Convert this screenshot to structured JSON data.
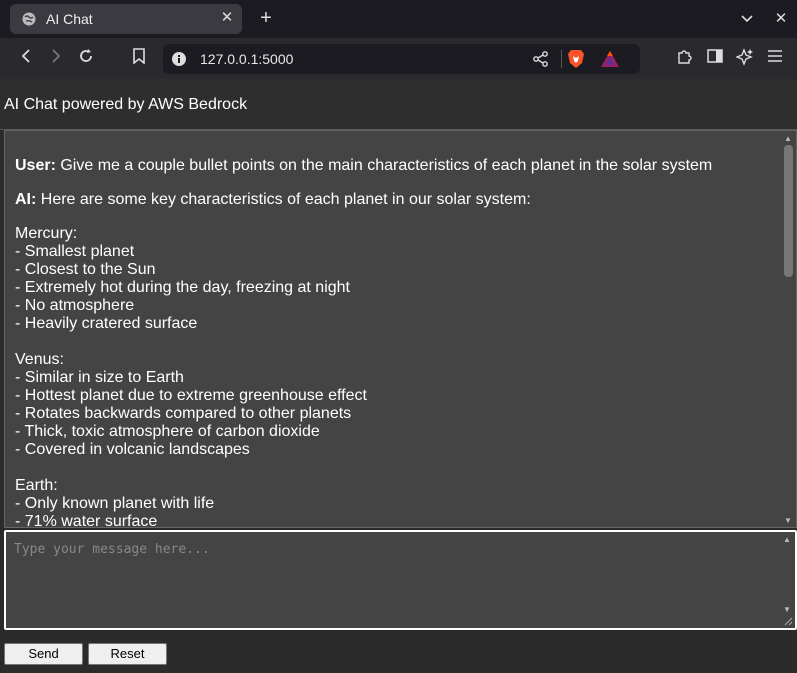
{
  "browser": {
    "tab_title": "AI Chat",
    "url": "127.0.0.1:5000"
  },
  "app": {
    "header_title": "AI Chat powered by AWS Bedrock"
  },
  "chat": {
    "messages": [
      {
        "speaker": "User:",
        "text": " Give me a couple bullet points on the main characteristics of each planet in the solar system"
      },
      {
        "speaker": "AI:",
        "text": " Here are some key characteristics of each planet in our solar system:"
      }
    ],
    "ai_body": "Mercury:\n- Smallest planet\n- Closest to the Sun\n- Extremely hot during the day, freezing at night\n- No atmosphere\n- Heavily cratered surface\n\nVenus:\n- Similar in size to Earth\n- Hottest planet due to extreme greenhouse effect\n- Rotates backwards compared to other planets\n- Thick, toxic atmosphere of carbon dioxide\n- Covered in volcanic landscapes\n\nEarth:\n- Only known planet with life\n- 71% water surface"
  },
  "input": {
    "placeholder": "Type your message here...",
    "value": ""
  },
  "buttons": {
    "send": "Send",
    "reset": "Reset"
  }
}
